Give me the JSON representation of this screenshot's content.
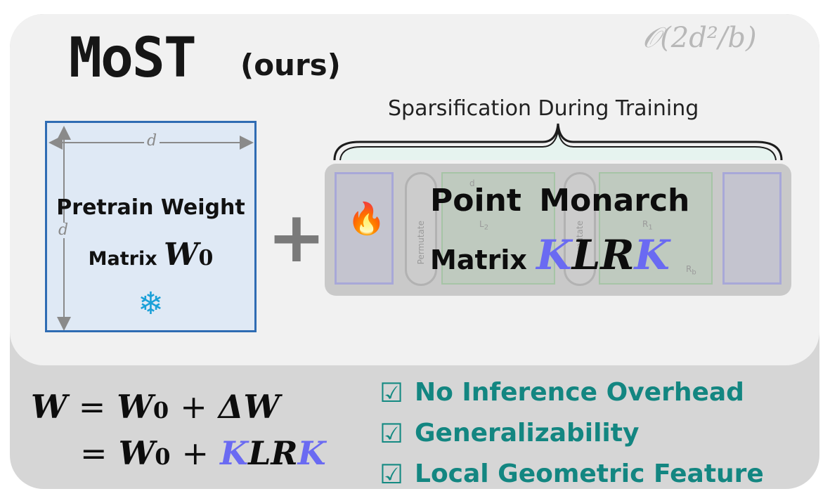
{
  "title": {
    "main": "MoST",
    "suffix": "(ours)"
  },
  "complexity": "𝒪(2d²/b)",
  "pretrain_box": {
    "line1": "Pretrain Weight",
    "line2_prefix": "Matrix",
    "symbol": "W",
    "subscript": "0",
    "dim_label_top": "d",
    "dim_label_left": "d",
    "icon": "snowflake-icon",
    "icon_glyph": "❄"
  },
  "plus": "+",
  "sparsification_label": "Sparsification During Training",
  "monarch_box": {
    "line1": "Point  Monarch",
    "line2_prefix": "Matrix",
    "symbol_parts": [
      "K",
      "LR",
      "K"
    ],
    "icon": "flame-icon",
    "icon_glyph": "🔥",
    "ghost_labels": {
      "permutate1": "Permutate",
      "permutate2": "Permutate",
      "block1_top": "d",
      "block1_mid": "L",
      "block1_sub": "2",
      "block2_mid": "R",
      "block2_sub": "1",
      "block2_bottom": "R",
      "block2_bottom_sub": "b"
    }
  },
  "equation": {
    "line1": {
      "lhs": "W",
      "eq": "=",
      "term1": "W",
      "term1_sub": "0",
      "op": "+",
      "term2": "ΔW"
    },
    "line2": {
      "eq": "=",
      "term1": "W",
      "term1_sub": "0",
      "op": "+",
      "k1": "K",
      "lr": "LR",
      "k2": "K"
    }
  },
  "benefits": [
    {
      "check": "☑",
      "label": "No Inference Overhead"
    },
    {
      "check": "☑",
      "label": "Generalizability"
    },
    {
      "check": "☑",
      "label": "Local Geometric Feature"
    }
  ],
  "colors": {
    "accent_teal": "#138681",
    "pretrain_border": "#2f6cb3",
    "pretrain_fill": "#dfe9f5",
    "k_blue": "#6a6af2",
    "flame_red": "#ee2a1a",
    "snowflake_blue": "#1aa0d8"
  }
}
